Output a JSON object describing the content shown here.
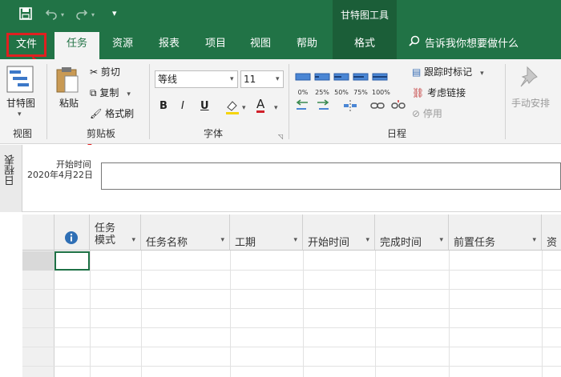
{
  "qat": {
    "save_icon": "save-icon",
    "undo_icon": "undo-icon",
    "redo_icon": "redo-icon",
    "customize_icon": "customize-qat-icon"
  },
  "context_tab_title": "甘特图工具",
  "tabs": [
    {
      "label": "文件"
    },
    {
      "label": "任务"
    },
    {
      "label": "资源"
    },
    {
      "label": "报表"
    },
    {
      "label": "项目"
    },
    {
      "label": "视图"
    },
    {
      "label": "帮助"
    },
    {
      "label": "格式"
    }
  ],
  "search": {
    "label": "告诉我你想要做什么"
  },
  "ribbon": {
    "view_group": {
      "gantt_label": "甘特图",
      "group_label": "视图"
    },
    "clipboard_group": {
      "paste_label": "粘贴",
      "cut_label": "剪切",
      "copy_label": "复制",
      "format_painter_label": "格式刷",
      "group_label": "剪贴板"
    },
    "font_group": {
      "font_name": "等线",
      "font_size": "11",
      "bold": "B",
      "italic": "I",
      "underline": "U",
      "font_color_label": "A",
      "group_label": "字体"
    },
    "schedule_group": {
      "percents": [
        "0%",
        "25%",
        "50%",
        "75%",
        "100%"
      ],
      "mark_on_track_label": "跟踪时标记",
      "respect_links_label": "考虑链接",
      "inactivate_label": "停用",
      "group_label": "日程"
    },
    "manual_schedule_label": "手动安排"
  },
  "timeline": {
    "vertical_label": "日程表",
    "start_label": "开始时间",
    "start_date": "2020年4月22日"
  },
  "grid": {
    "columns": [
      {
        "label": "任务模式"
      },
      {
        "label": "任务名称"
      },
      {
        "label": "工期"
      },
      {
        "label": "开始时间"
      },
      {
        "label": "完成时间"
      },
      {
        "label": "前置任务"
      },
      {
        "label": "资"
      }
    ],
    "mode_label_line1": "任务",
    "mode_label_line2": "模式"
  },
  "colors": {
    "brand": "#217346",
    "accent_highlight": "#e02020",
    "info_icon": "#2f6fb5"
  }
}
